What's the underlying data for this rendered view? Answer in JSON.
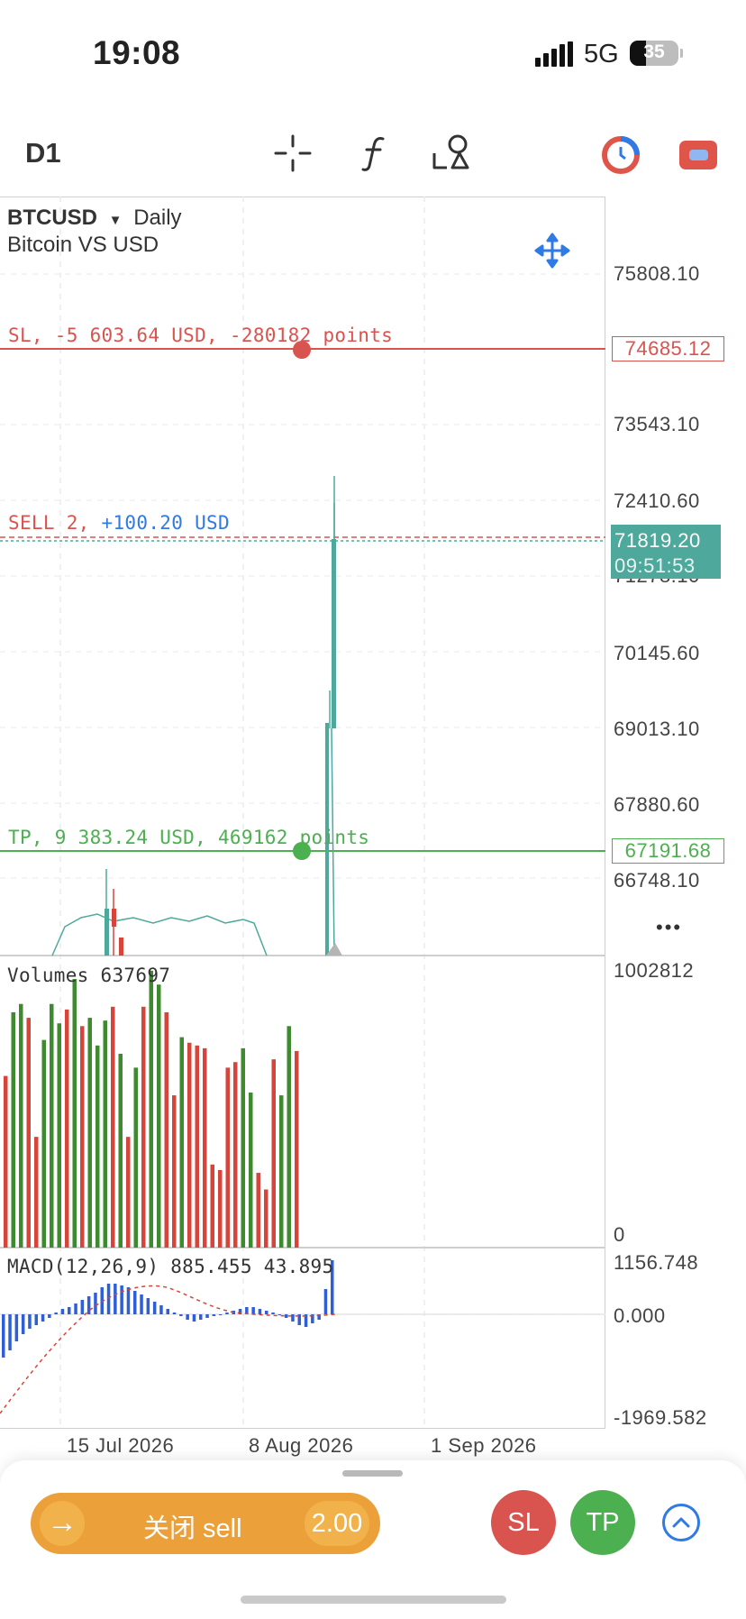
{
  "status_bar": {
    "time": "19:08",
    "network": "5G",
    "battery": "35"
  },
  "toolbar": {
    "timeframe": "D1",
    "icons": [
      "crosshair-icon",
      "indicator-function-icon",
      "drawing-objects-icon",
      "timer-icon",
      "trade-icon"
    ],
    "colors": {
      "timer": "#e0554a",
      "timer_inner": "#2f7ae5",
      "trade": "#e0554a"
    }
  },
  "chart": {
    "symbol": "BTCUSD",
    "period": "Daily",
    "description": "Bitcoin VS USD",
    "price_axis": [
      "75808.10",
      "73543.10",
      "72410.60",
      "71278.10",
      "70145.60",
      "69013.10",
      "67880.60",
      "66748.10"
    ],
    "sl_line": {
      "prefix": "SL, ",
      "text": "-5 603.64 USD, -280182 points",
      "price": "74685.12",
      "color": "#d9534f"
    },
    "position_line": {
      "prefix": "SELL 2, ",
      "profit": "+100.20 USD",
      "color": "#d9534f",
      "profit_color": "#2f7ae5"
    },
    "current_price": {
      "price": "71819.20",
      "countdown": "09:51:53",
      "color": "#4ea89c"
    },
    "tp_line": {
      "prefix": "TP, ",
      "text": "9 383.24 USD, 469162 points",
      "price": "67191.68",
      "color": "#4caf50"
    },
    "more_label": "•••"
  },
  "volumes": {
    "title": "Volumes 637697",
    "axis_top": "1002812",
    "axis_bottom": "0"
  },
  "macd": {
    "title": "MACD(12,26,9) 885.455 43.895",
    "axis_top": "1156.748",
    "axis_mid": "0.000",
    "axis_bottom": "-1969.582"
  },
  "time_axis": [
    "15 Jul 2026",
    "8 Aug 2026",
    "1 Sep 2026"
  ],
  "chart_data": {
    "type": "bar",
    "title": "Volumes 637697",
    "ylim": [
      0,
      1002812
    ],
    "values": [
      620000,
      850000,
      880000,
      830000,
      400000,
      750000,
      880000,
      810000,
      860000,
      970000,
      800000,
      830000,
      730000,
      820000,
      870000,
      700000,
      400000,
      650000,
      870000,
      1000000,
      950000,
      850000,
      550000,
      760000,
      740000,
      730000,
      720000,
      300000,
      280000,
      650000,
      670000,
      720000,
      560000,
      270000,
      210000,
      680000,
      550000,
      800000,
      710000
    ],
    "directions": [
      "down",
      "up",
      "up",
      "down",
      "down",
      "up",
      "up",
      "up",
      "down",
      "up",
      "down",
      "up",
      "up",
      "up",
      "down",
      "up",
      "down",
      "up",
      "down",
      "up",
      "up",
      "down",
      "down",
      "up",
      "down",
      "down",
      "down",
      "down",
      "down",
      "down",
      "down",
      "up",
      "up",
      "down",
      "down",
      "down",
      "up",
      "up",
      "down"
    ],
    "colors": {
      "up": "#3d8b2e",
      "down": "#d7453a"
    }
  },
  "bottom_sheet": {
    "close_label": "关闭 sell",
    "volume": "2.00",
    "sl": "SL",
    "tp": "TP"
  }
}
